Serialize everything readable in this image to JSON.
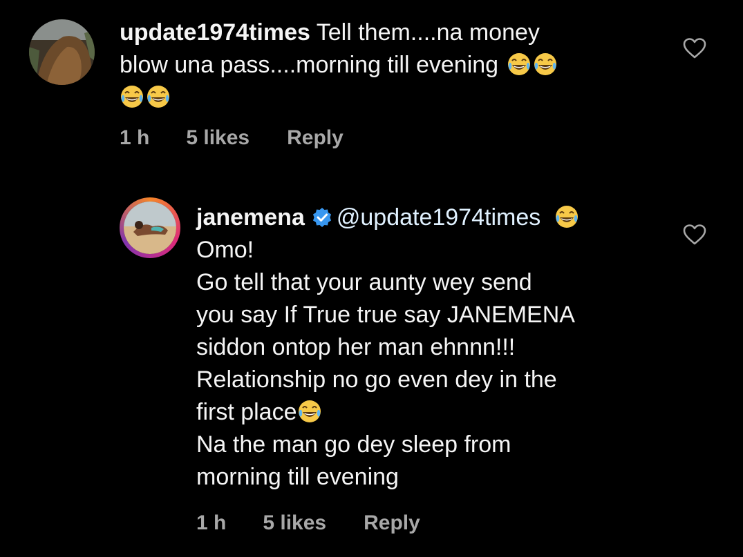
{
  "comments": [
    {
      "username": "update1974times",
      "text_line1": "Tell them....na money",
      "text_line2": "blow una pass....morning till evening",
      "time": "1 h",
      "likes": "5 likes",
      "reply_label": "Reply",
      "avatar": "profile-photo-brown-animal",
      "like_icon": "heart-outline-icon"
    },
    {
      "username": "janemena",
      "verified": true,
      "mention": "@update1974times",
      "lines": [
        "Omo!",
        "Go tell that your aunty wey send",
        "you say If True true say JANEMENA",
        "siddon ontop her man ehnnn!!!",
        "Relationship no go even dey in the",
        "first place",
        "Na the man go dey sleep from",
        "morning till evening"
      ],
      "time": "1 h",
      "likes": "5 likes",
      "reply_label": "Reply",
      "avatar": "profile-photo-beach-story-ring",
      "like_icon": "heart-outline-icon"
    }
  ],
  "colors": {
    "background": "#000000",
    "text": "#f5f5f5",
    "meta": "#a8a8a8",
    "verified_blue": "#3897f0",
    "story_ring_start": "#f58529",
    "story_ring_end": "#dd2a7b"
  }
}
